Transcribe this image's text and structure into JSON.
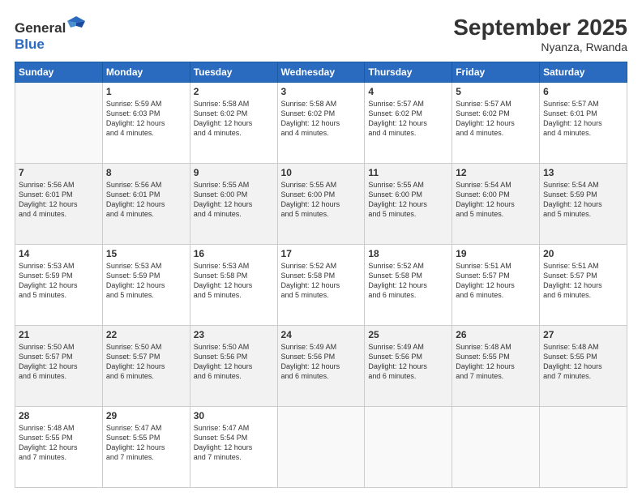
{
  "header": {
    "logo_general": "General",
    "logo_blue": "Blue",
    "title": "September 2025",
    "subtitle": "Nyanza, Rwanda"
  },
  "weekdays": [
    "Sunday",
    "Monday",
    "Tuesday",
    "Wednesday",
    "Thursday",
    "Friday",
    "Saturday"
  ],
  "weeks": [
    [
      {
        "num": "",
        "info": ""
      },
      {
        "num": "1",
        "info": "Sunrise: 5:59 AM\nSunset: 6:03 PM\nDaylight: 12 hours\nand 4 minutes."
      },
      {
        "num": "2",
        "info": "Sunrise: 5:58 AM\nSunset: 6:02 PM\nDaylight: 12 hours\nand 4 minutes."
      },
      {
        "num": "3",
        "info": "Sunrise: 5:58 AM\nSunset: 6:02 PM\nDaylight: 12 hours\nand 4 minutes."
      },
      {
        "num": "4",
        "info": "Sunrise: 5:57 AM\nSunset: 6:02 PM\nDaylight: 12 hours\nand 4 minutes."
      },
      {
        "num": "5",
        "info": "Sunrise: 5:57 AM\nSunset: 6:02 PM\nDaylight: 12 hours\nand 4 minutes."
      },
      {
        "num": "6",
        "info": "Sunrise: 5:57 AM\nSunset: 6:01 PM\nDaylight: 12 hours\nand 4 minutes."
      }
    ],
    [
      {
        "num": "7",
        "info": "Sunrise: 5:56 AM\nSunset: 6:01 PM\nDaylight: 12 hours\nand 4 minutes."
      },
      {
        "num": "8",
        "info": "Sunrise: 5:56 AM\nSunset: 6:01 PM\nDaylight: 12 hours\nand 4 minutes."
      },
      {
        "num": "9",
        "info": "Sunrise: 5:55 AM\nSunset: 6:00 PM\nDaylight: 12 hours\nand 4 minutes."
      },
      {
        "num": "10",
        "info": "Sunrise: 5:55 AM\nSunset: 6:00 PM\nDaylight: 12 hours\nand 5 minutes."
      },
      {
        "num": "11",
        "info": "Sunrise: 5:55 AM\nSunset: 6:00 PM\nDaylight: 12 hours\nand 5 minutes."
      },
      {
        "num": "12",
        "info": "Sunrise: 5:54 AM\nSunset: 6:00 PM\nDaylight: 12 hours\nand 5 minutes."
      },
      {
        "num": "13",
        "info": "Sunrise: 5:54 AM\nSunset: 5:59 PM\nDaylight: 12 hours\nand 5 minutes."
      }
    ],
    [
      {
        "num": "14",
        "info": "Sunrise: 5:53 AM\nSunset: 5:59 PM\nDaylight: 12 hours\nand 5 minutes."
      },
      {
        "num": "15",
        "info": "Sunrise: 5:53 AM\nSunset: 5:59 PM\nDaylight: 12 hours\nand 5 minutes."
      },
      {
        "num": "16",
        "info": "Sunrise: 5:53 AM\nSunset: 5:58 PM\nDaylight: 12 hours\nand 5 minutes."
      },
      {
        "num": "17",
        "info": "Sunrise: 5:52 AM\nSunset: 5:58 PM\nDaylight: 12 hours\nand 5 minutes."
      },
      {
        "num": "18",
        "info": "Sunrise: 5:52 AM\nSunset: 5:58 PM\nDaylight: 12 hours\nand 6 minutes."
      },
      {
        "num": "19",
        "info": "Sunrise: 5:51 AM\nSunset: 5:57 PM\nDaylight: 12 hours\nand 6 minutes."
      },
      {
        "num": "20",
        "info": "Sunrise: 5:51 AM\nSunset: 5:57 PM\nDaylight: 12 hours\nand 6 minutes."
      }
    ],
    [
      {
        "num": "21",
        "info": "Sunrise: 5:50 AM\nSunset: 5:57 PM\nDaylight: 12 hours\nand 6 minutes."
      },
      {
        "num": "22",
        "info": "Sunrise: 5:50 AM\nSunset: 5:57 PM\nDaylight: 12 hours\nand 6 minutes."
      },
      {
        "num": "23",
        "info": "Sunrise: 5:50 AM\nSunset: 5:56 PM\nDaylight: 12 hours\nand 6 minutes."
      },
      {
        "num": "24",
        "info": "Sunrise: 5:49 AM\nSunset: 5:56 PM\nDaylight: 12 hours\nand 6 minutes."
      },
      {
        "num": "25",
        "info": "Sunrise: 5:49 AM\nSunset: 5:56 PM\nDaylight: 12 hours\nand 6 minutes."
      },
      {
        "num": "26",
        "info": "Sunrise: 5:48 AM\nSunset: 5:55 PM\nDaylight: 12 hours\nand 7 minutes."
      },
      {
        "num": "27",
        "info": "Sunrise: 5:48 AM\nSunset: 5:55 PM\nDaylight: 12 hours\nand 7 minutes."
      }
    ],
    [
      {
        "num": "28",
        "info": "Sunrise: 5:48 AM\nSunset: 5:55 PM\nDaylight: 12 hours\nand 7 minutes."
      },
      {
        "num": "29",
        "info": "Sunrise: 5:47 AM\nSunset: 5:55 PM\nDaylight: 12 hours\nand 7 minutes."
      },
      {
        "num": "30",
        "info": "Sunrise: 5:47 AM\nSunset: 5:54 PM\nDaylight: 12 hours\nand 7 minutes."
      },
      {
        "num": "",
        "info": ""
      },
      {
        "num": "",
        "info": ""
      },
      {
        "num": "",
        "info": ""
      },
      {
        "num": "",
        "info": ""
      }
    ]
  ]
}
